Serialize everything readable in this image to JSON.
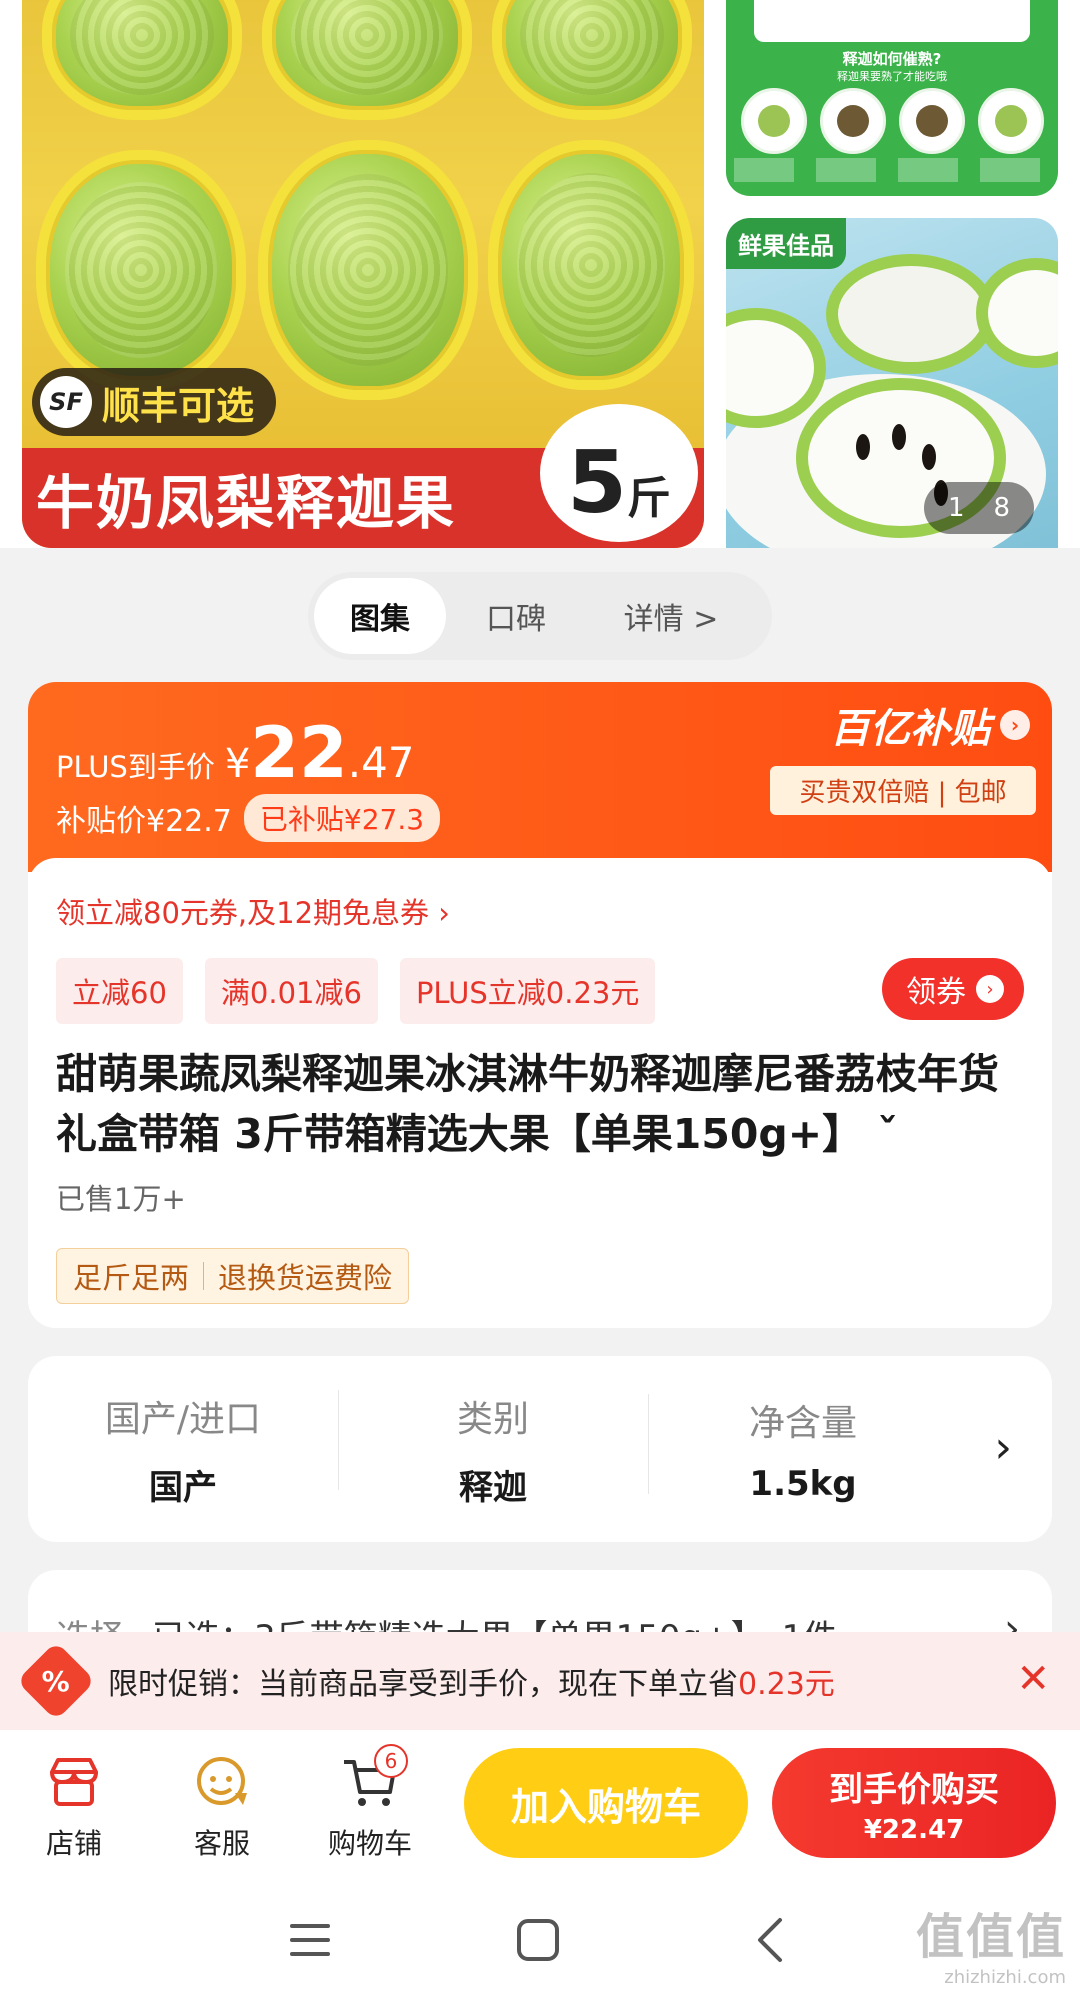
{
  "gallery": {
    "hero": {
      "shipping_badge_logo": "SF",
      "shipping_badge": "顺丰可选",
      "title": "牛奶凤梨释迦果",
      "weight_num": "5",
      "weight_unit": "斤"
    },
    "side_top": {
      "question": "释迦如何催熟?",
      "question_sub": "释迦果要熟了才能吃哦"
    },
    "side_bottom": {
      "tag": "鲜果佳品",
      "counter_current": "1",
      "counter_total": "8"
    }
  },
  "tabs": [
    "图集",
    "口碑",
    "详情 >"
  ],
  "price": {
    "plus_label": "PLUS到手价",
    "currency": "¥",
    "amount_int": "22",
    "amount_dec": ".47",
    "subsidy_price": "补贴价¥22.7",
    "subsidy_tag": "已补贴¥27.3",
    "yi_title": "百亿补贴",
    "yi_sub": "买贵双倍赔 | 包邮"
  },
  "coupons": {
    "line": "领立减80元券,及12期免息券 ›",
    "chips": [
      "立减60",
      "满0.01减6",
      "PLUS立减0.23元"
    ],
    "get_label": "领券"
  },
  "product": {
    "title": "甜萌果蔬凤梨释迦果冰淇淋牛奶释迦摩尼番荔枝年货礼盒带箱 3斤带箱精选大果【单果150g+】 ˇ",
    "sold": "已售1万+",
    "services": [
      "足斤足两",
      "退换货运费险"
    ]
  },
  "specs": [
    {
      "label": "国产/进口",
      "value": "国产"
    },
    {
      "label": "类别",
      "value": "释迦"
    },
    {
      "label": "净含量",
      "value": "1.5kg"
    }
  ],
  "select_row": {
    "label": "选择",
    "value": "已选：3斤带箱精选大果【单果150g+】，1件"
  },
  "promo": {
    "icon_text": "%",
    "text": "限时促销：当前商品享受到手价，现在下单立省",
    "highlight": "0.23元"
  },
  "bottom_bar": {
    "shop": "店铺",
    "service": "客服",
    "cart": "购物车",
    "cart_count": "6",
    "add_to_cart": "加入购物车",
    "buy_label": "到手价购买",
    "buy_price": "¥22.47"
  },
  "watermark": {
    "main": "值值值",
    "url": "zhizhizhi.com"
  },
  "colors": {
    "accent_red": "#e5352b",
    "orange": "#ff5a18",
    "yellow_button": "#ffce14",
    "green": "#3bb24a"
  }
}
